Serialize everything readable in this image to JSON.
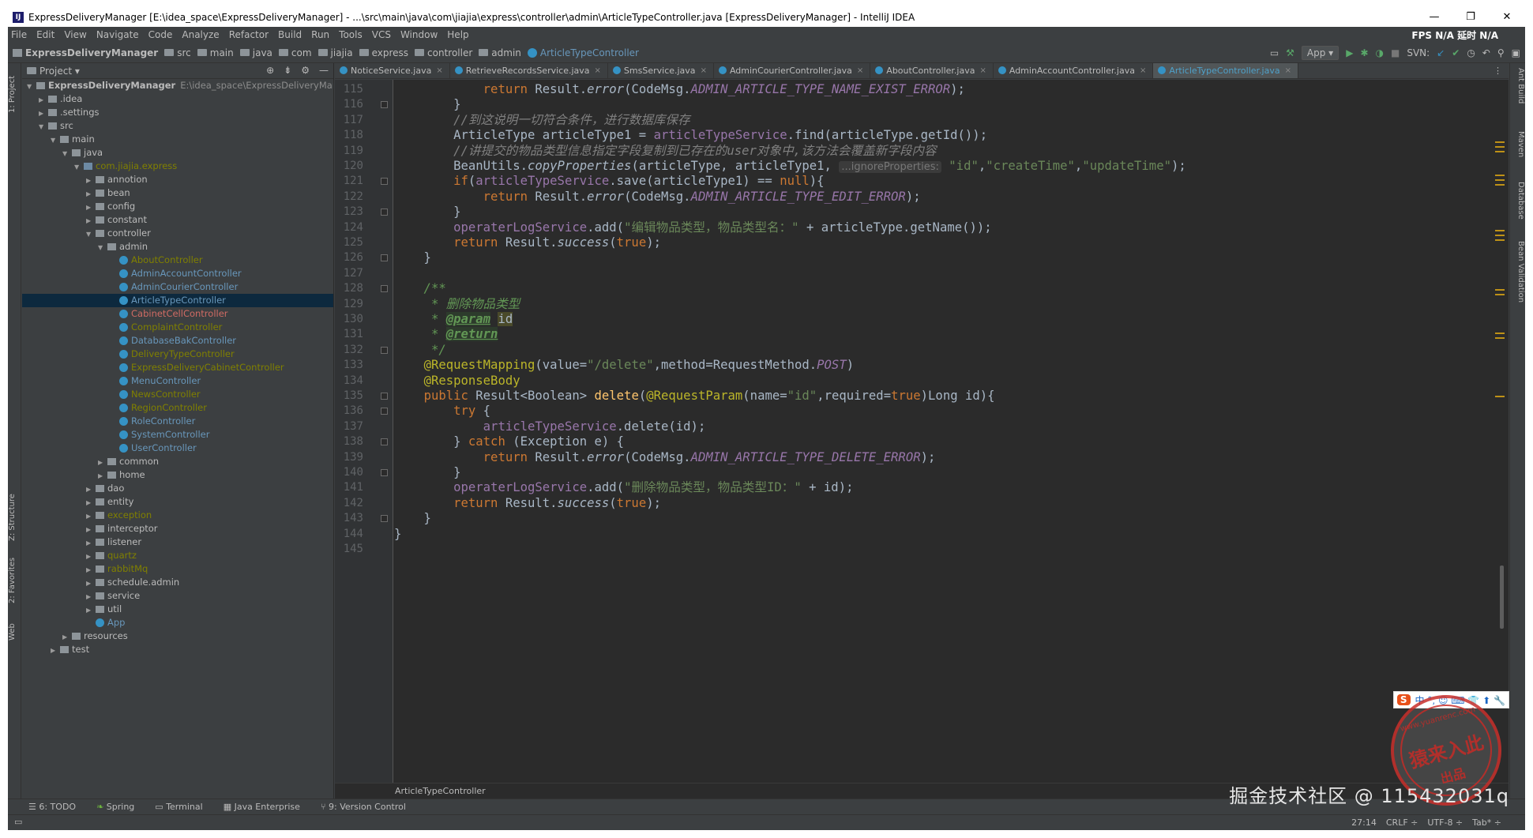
{
  "window": {
    "title": "ExpressDeliveryManager [E:\\idea_space\\ExpressDeliveryManager] - ...\\src\\main\\java\\com\\jiajia\\express\\controller\\admin\\ArticleTypeController.java [ExpressDeliveryManager] - IntelliJ IDEA",
    "logo": "IJ",
    "controls": [
      "—",
      "❐",
      "✕"
    ]
  },
  "menu": {
    "items": [
      "File",
      "Edit",
      "View",
      "Navigate",
      "Code",
      "Analyze",
      "Refactor",
      "Build",
      "Run",
      "Tools",
      "VCS",
      "Window",
      "Help"
    ],
    "fps": "FPS  N/A  延时  N/A"
  },
  "nav": {
    "crumbs": [
      "ExpressDeliveryManager",
      "src",
      "main",
      "java",
      "com",
      "jiajia",
      "express",
      "controller",
      "admin",
      "ArticleTypeController"
    ],
    "run_config": "App ▾",
    "svn_label": "SVN:"
  },
  "side_labels": {
    "left": [
      "1: Project",
      "Z: Structure",
      "2: Favorites",
      "Web"
    ],
    "right": [
      "Ant Build",
      "Maven",
      "Database",
      "Bean Validation"
    ]
  },
  "project": {
    "title": "Project ▾",
    "tree": [
      {
        "label": "ExpressDeliveryManager",
        "hint": "E:\\idea_space\\ExpressDeliveryManager",
        "depth": 0,
        "arrow": "▼",
        "icon": "proj",
        "bold": true
      },
      {
        "label": ".idea",
        "depth": 1,
        "arrow": "▶",
        "icon": "folder"
      },
      {
        "label": ".settings",
        "depth": 1,
        "arrow": "▶",
        "icon": "folder"
      },
      {
        "label": "src",
        "depth": 1,
        "arrow": "▼",
        "icon": "folder"
      },
      {
        "label": "main",
        "depth": 2,
        "arrow": "▼",
        "icon": "folder"
      },
      {
        "label": "java",
        "depth": 3,
        "arrow": "▼",
        "icon": "folder"
      },
      {
        "label": "com.jiajia.express",
        "depth": 4,
        "arrow": "▼",
        "icon": "pkg",
        "color": "olive"
      },
      {
        "label": "annotion",
        "depth": 5,
        "arrow": "▶",
        "icon": "folder"
      },
      {
        "label": "bean",
        "depth": 5,
        "arrow": "▶",
        "icon": "folder"
      },
      {
        "label": "config",
        "depth": 5,
        "arrow": "▶",
        "icon": "folder"
      },
      {
        "label": "constant",
        "depth": 5,
        "arrow": "▶",
        "icon": "folder"
      },
      {
        "label": "controller",
        "depth": 5,
        "arrow": "▼",
        "icon": "folder"
      },
      {
        "label": "admin",
        "depth": 6,
        "arrow": "▼",
        "icon": "folder"
      },
      {
        "label": "AboutController",
        "depth": 7,
        "arrow": "",
        "icon": "class",
        "color": "olive"
      },
      {
        "label": "AdminAccountController",
        "depth": 7,
        "arrow": "",
        "icon": "class",
        "color": "blue"
      },
      {
        "label": "AdminCourierController",
        "depth": 7,
        "arrow": "",
        "icon": "class",
        "color": "blue"
      },
      {
        "label": "ArticleTypeController",
        "depth": 7,
        "arrow": "",
        "icon": "class",
        "color": "blue",
        "selected": true
      },
      {
        "label": "CabinetCellController",
        "depth": 7,
        "arrow": "",
        "icon": "class",
        "color": "red"
      },
      {
        "label": "ComplaintController",
        "depth": 7,
        "arrow": "",
        "icon": "class",
        "color": "olive"
      },
      {
        "label": "DatabaseBakController",
        "depth": 7,
        "arrow": "",
        "icon": "class",
        "color": "blue"
      },
      {
        "label": "DeliveryTypeController",
        "depth": 7,
        "arrow": "",
        "icon": "class",
        "color": "olive"
      },
      {
        "label": "ExpressDeliveryCabinetController",
        "depth": 7,
        "arrow": "",
        "icon": "class",
        "color": "olive"
      },
      {
        "label": "MenuController",
        "depth": 7,
        "arrow": "",
        "icon": "class",
        "color": "blue"
      },
      {
        "label": "NewsController",
        "depth": 7,
        "arrow": "",
        "icon": "class",
        "color": "olive"
      },
      {
        "label": "RegionController",
        "depth": 7,
        "arrow": "",
        "icon": "class",
        "color": "olive"
      },
      {
        "label": "RoleController",
        "depth": 7,
        "arrow": "",
        "icon": "class",
        "color": "blue"
      },
      {
        "label": "SystemController",
        "depth": 7,
        "arrow": "",
        "icon": "class",
        "color": "blue"
      },
      {
        "label": "UserController",
        "depth": 7,
        "arrow": "",
        "icon": "class",
        "color": "blue"
      },
      {
        "label": "common",
        "depth": 6,
        "arrow": "▶",
        "icon": "folder"
      },
      {
        "label": "home",
        "depth": 6,
        "arrow": "▶",
        "icon": "folder"
      },
      {
        "label": "dao",
        "depth": 5,
        "arrow": "▶",
        "icon": "folder"
      },
      {
        "label": "entity",
        "depth": 5,
        "arrow": "▶",
        "icon": "folder"
      },
      {
        "label": "exception",
        "depth": 5,
        "arrow": "▶",
        "icon": "folder",
        "color": "olive"
      },
      {
        "label": "interceptor",
        "depth": 5,
        "arrow": "▶",
        "icon": "folder"
      },
      {
        "label": "listener",
        "depth": 5,
        "arrow": "▶",
        "icon": "folder"
      },
      {
        "label": "quartz",
        "depth": 5,
        "arrow": "▶",
        "icon": "folder",
        "color": "olive"
      },
      {
        "label": "rabbitMq",
        "depth": 5,
        "arrow": "▶",
        "icon": "folder",
        "color": "olive"
      },
      {
        "label": "schedule.admin",
        "depth": 5,
        "arrow": "▶",
        "icon": "folder"
      },
      {
        "label": "service",
        "depth": 5,
        "arrow": "▶",
        "icon": "folder"
      },
      {
        "label": "util",
        "depth": 5,
        "arrow": "▶",
        "icon": "folder"
      },
      {
        "label": "App",
        "depth": 5,
        "arrow": "",
        "icon": "class",
        "color": "blue"
      },
      {
        "label": "resources",
        "depth": 3,
        "arrow": "▶",
        "icon": "folder"
      },
      {
        "label": "test",
        "depth": 2,
        "arrow": "▶",
        "icon": "folder"
      }
    ]
  },
  "tabs": [
    {
      "label": "NoticeService.java",
      "active": false
    },
    {
      "label": "RetrieveRecordsService.java",
      "active": false
    },
    {
      "label": "SmsService.java",
      "active": false
    },
    {
      "label": "AdminCourierController.java",
      "active": false
    },
    {
      "label": "AboutController.java",
      "active": false
    },
    {
      "label": "AdminAccountController.java",
      "active": false
    },
    {
      "label": "ArticleTypeController.java",
      "active": true
    }
  ],
  "editor": {
    "line_numbers": [
      "115",
      "116",
      "117",
      "118",
      "119",
      "120",
      "121",
      "122",
      "123",
      "124",
      "125",
      "126",
      "127",
      "128",
      "129",
      "130",
      "131",
      "132",
      "133",
      "134",
      "135",
      "136",
      "137",
      "138",
      "139",
      "140",
      "141",
      "142",
      "143",
      "144",
      "145"
    ],
    "footer": "ArticleTypeController",
    "lines": [
      [
        {
          "t": "            "
        },
        {
          "t": "return ",
          "c": "kw"
        },
        {
          "t": "Result."
        },
        {
          "t": "error",
          "c": "it"
        },
        {
          "t": "(CodeMsg."
        },
        {
          "t": "ADMIN_ARTICLE_TYPE_NAME_EXIST_ERROR",
          "c": "cst"
        },
        {
          "t": ");"
        }
      ],
      [
        {
          "t": "        }"
        }
      ],
      [
        {
          "t": "        //到这说明一切符合条件，进行数据库保存",
          "c": "cmt"
        }
      ],
      [
        {
          "t": "        ArticleType articleType1 = "
        },
        {
          "t": "articleTypeService",
          "c": "fld"
        },
        {
          "t": ".find(articleType.getId());"
        }
      ],
      [
        {
          "t": "        //讲提交的物品类型信息指定字段复制到已存在的user对象中,该方法会覆盖新字段内容",
          "c": "cmt"
        }
      ],
      [
        {
          "t": "        BeanUtils."
        },
        {
          "t": "copyProperties",
          "c": "it"
        },
        {
          "t": "(articleType, articleType1, "
        },
        {
          "t": "...ignoreProperties:",
          "c": "hint2"
        },
        {
          "t": " "
        },
        {
          "t": "\"id\"",
          "c": "str"
        },
        {
          "t": ","
        },
        {
          "t": "\"createTime\"",
          "c": "str"
        },
        {
          "t": ","
        },
        {
          "t": "\"updateTime\"",
          "c": "str"
        },
        {
          "t": ");"
        }
      ],
      [
        {
          "t": "        "
        },
        {
          "t": "if",
          "c": "kw"
        },
        {
          "t": "("
        },
        {
          "t": "articleTypeService",
          "c": "fld"
        },
        {
          "t": ".save(articleType1) == "
        },
        {
          "t": "null",
          "c": "kw"
        },
        {
          "t": "){"
        }
      ],
      [
        {
          "t": "            "
        },
        {
          "t": "return ",
          "c": "kw"
        },
        {
          "t": "Result."
        },
        {
          "t": "error",
          "c": "it"
        },
        {
          "t": "(CodeMsg."
        },
        {
          "t": "ADMIN_ARTICLE_TYPE_EDIT_ERROR",
          "c": "cst"
        },
        {
          "t": ");"
        }
      ],
      [
        {
          "t": "        }"
        }
      ],
      [
        {
          "t": "        "
        },
        {
          "t": "operaterLogService",
          "c": "fld"
        },
        {
          "t": ".add("
        },
        {
          "t": "\"编辑物品类型，物品类型名：\"",
          "c": "str"
        },
        {
          "t": " + articleType.getName());"
        }
      ],
      [
        {
          "t": "        "
        },
        {
          "t": "return ",
          "c": "kw"
        },
        {
          "t": "Result."
        },
        {
          "t": "success",
          "c": "it"
        },
        {
          "t": "("
        },
        {
          "t": "true",
          "c": "kw"
        },
        {
          "t": ");"
        }
      ],
      [
        {
          "t": "    }"
        }
      ],
      [
        {
          "t": ""
        }
      ],
      [
        {
          "t": "    /**",
          "c": "doc"
        }
      ],
      [
        {
          "t": "     * 删除物品类型",
          "c": "doc"
        }
      ],
      [
        {
          "t": "     * ",
          "c": "doc"
        },
        {
          "t": "@param",
          "c": "doctag"
        },
        {
          "t": " "
        },
        {
          "t": "id",
          "c": "param"
        }
      ],
      [
        {
          "t": "     * ",
          "c": "doc"
        },
        {
          "t": "@return",
          "c": "doctag"
        }
      ],
      [
        {
          "t": "     */",
          "c": "doc"
        }
      ],
      [
        {
          "t": "    "
        },
        {
          "t": "@RequestMapping",
          "c": "ann"
        },
        {
          "t": "(value="
        },
        {
          "t": "\"/delete\"",
          "c": "str"
        },
        {
          "t": ",method=RequestMethod."
        },
        {
          "t": "POST",
          "c": "cst"
        },
        {
          "t": ")"
        }
      ],
      [
        {
          "t": "    "
        },
        {
          "t": "@ResponseBody",
          "c": "ann"
        }
      ],
      [
        {
          "t": "    "
        },
        {
          "t": "public ",
          "c": "kw"
        },
        {
          "t": "Result<Boolean> "
        },
        {
          "t": "delete",
          "c": "mth"
        },
        {
          "t": "("
        },
        {
          "t": "@RequestParam",
          "c": "ann"
        },
        {
          "t": "(name="
        },
        {
          "t": "\"id\"",
          "c": "str"
        },
        {
          "t": ",required="
        },
        {
          "t": "true",
          "c": "kw"
        },
        {
          "t": ")Long id){"
        }
      ],
      [
        {
          "t": "        "
        },
        {
          "t": "try ",
          "c": "kw"
        },
        {
          "t": "{"
        }
      ],
      [
        {
          "t": "            "
        },
        {
          "t": "articleTypeService",
          "c": "fld"
        },
        {
          "t": ".delete(id);"
        }
      ],
      [
        {
          "t": "        } "
        },
        {
          "t": "catch ",
          "c": "kw"
        },
        {
          "t": "(Exception e) {"
        }
      ],
      [
        {
          "t": "            "
        },
        {
          "t": "return ",
          "c": "kw"
        },
        {
          "t": "Result."
        },
        {
          "t": "error",
          "c": "it"
        },
        {
          "t": "(CodeMsg."
        },
        {
          "t": "ADMIN_ARTICLE_TYPE_DELETE_ERROR",
          "c": "cst"
        },
        {
          "t": ");"
        }
      ],
      [
        {
          "t": "        }"
        }
      ],
      [
        {
          "t": "        "
        },
        {
          "t": "operaterLogService",
          "c": "fld"
        },
        {
          "t": ".add("
        },
        {
          "t": "\"删除物品类型，物品类型ID：\"",
          "c": "str"
        },
        {
          "t": " + id);"
        }
      ],
      [
        {
          "t": "        "
        },
        {
          "t": "return ",
          "c": "kw"
        },
        {
          "t": "Result."
        },
        {
          "t": "success",
          "c": "it"
        },
        {
          "t": "("
        },
        {
          "t": "true",
          "c": "kw"
        },
        {
          "t": ");"
        }
      ],
      [
        {
          "t": "    }"
        }
      ],
      [
        {
          "t": "}"
        }
      ],
      [
        {
          "t": ""
        }
      ]
    ]
  },
  "tool_windows": [
    "6: TODO",
    "Spring",
    "Terminal",
    "Java Enterprise",
    "9: Version Control"
  ],
  "status": {
    "position": "27:14",
    "line_sep": "CRLF ÷",
    "encoding": "UTF-8 ÷",
    "indent": "Tab* ÷"
  },
  "watermark": "掘金技术社区 @ 115432031q",
  "stamp": {
    "top": "www.yuanrenc.com",
    "mid": "猿来入此",
    "bottom": "出品"
  },
  "ime": {
    "logo": "S",
    "label": "中 °, ☺ ⌨ 👕 ⬆ 🔧"
  },
  "colors": {
    "bg": "#2b2b2b",
    "panel": "#3c3f41",
    "keyword": "#cc7832",
    "string": "#6a8759",
    "field": "#9876aa",
    "annotation": "#bbb529",
    "comment": "#808080"
  }
}
